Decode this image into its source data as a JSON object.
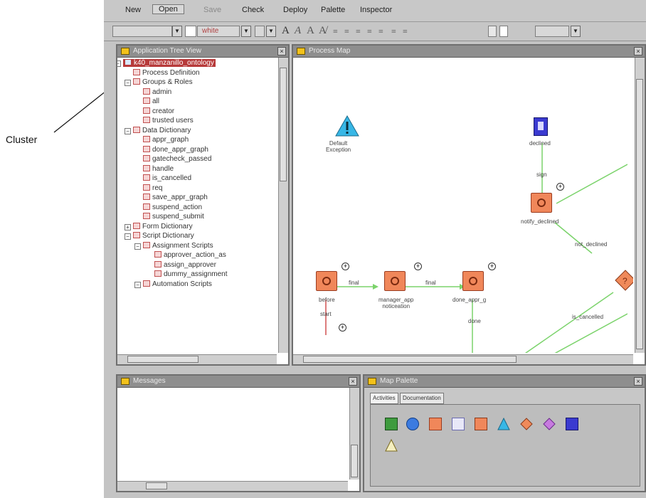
{
  "annotation": {
    "label": "Cluster"
  },
  "menubar": {
    "items": [
      "New",
      "Open",
      "Save",
      "Check",
      "Deploy",
      "Palette",
      "Inspector"
    ]
  },
  "toolbar": {
    "font_combo": "",
    "color_combo": "white",
    "format_glyphs": [
      "A",
      "A",
      "A",
      "A̸",
      "≡",
      "≡",
      "≡",
      "≡",
      "≡",
      "≡",
      "≡"
    ]
  },
  "tree_panel": {
    "title": "Application Tree View",
    "rows": [
      {
        "label": "k40_manzanillo_ontology",
        "selected": true,
        "color": "#b73a3a"
      },
      {
        "label": "Process Definition",
        "color": "#c05050"
      },
      {
        "label": "Groups & Roles",
        "color": "#c05050"
      },
      {
        "label": "admin",
        "color": "#c05050"
      },
      {
        "label": "all",
        "color": "#c05050"
      },
      {
        "label": "creator",
        "color": "#c05050"
      },
      {
        "label": "trusted users",
        "color": "#c05050"
      },
      {
        "label": "Data Dictionary",
        "color": "#c05050"
      },
      {
        "label": "appr_graph",
        "color": "#c05050"
      },
      {
        "label": "done_appr_graph",
        "color": "#c05050"
      },
      {
        "label": "gatecheck_passed",
        "color": "#c05050"
      },
      {
        "label": "handle",
        "color": "#c05050"
      },
      {
        "label": "is_cancelled",
        "color": "#c05050"
      },
      {
        "label": "req",
        "color": "#c05050"
      },
      {
        "label": "save_appr_graph",
        "color": "#c05050"
      },
      {
        "label": "suspend_action",
        "color": "#c05050"
      },
      {
        "label": "suspend_submit",
        "color": "#c05050"
      },
      {
        "label": "Form Dictionary",
        "color": "#c05050"
      },
      {
        "label": "Script Dictionary",
        "color": "#c05050"
      },
      {
        "label": "Assignment Scripts",
        "color": "#c05050"
      },
      {
        "label": "approver_action_as",
        "color": "#c05050"
      },
      {
        "label": "assign_approver",
        "color": "#c05050"
      },
      {
        "label": "dummy_assignment",
        "color": "#c05050"
      },
      {
        "label": "Automation Scripts",
        "color": "#c05050"
      }
    ]
  },
  "map_panel": {
    "title": "Process Map",
    "nodes": {
      "default": "Default\nException",
      "declined": "declined",
      "notify": "notify_declined",
      "notdeclined": "not_declined",
      "before": "before",
      "manager": "manager_app\nnoticeation",
      "done": "done_appr_g",
      "cancelled": "is_cancelled"
    },
    "edges": {
      "e1": "sign",
      "e2": "final",
      "e3": "final",
      "e4": "start",
      "e5": "done"
    }
  },
  "messages_panel": {
    "title": "Messages"
  },
  "palette_panel": {
    "title": "Map Palette",
    "tabs": [
      "Activities",
      "Documentation"
    ],
    "icons": [
      "start-icon",
      "approve-icon",
      "script-icon",
      "chart-icon",
      "notify-icon",
      "exception-icon",
      "decision-icon",
      "join-icon",
      "exit-icon",
      "warning-icon"
    ]
  }
}
